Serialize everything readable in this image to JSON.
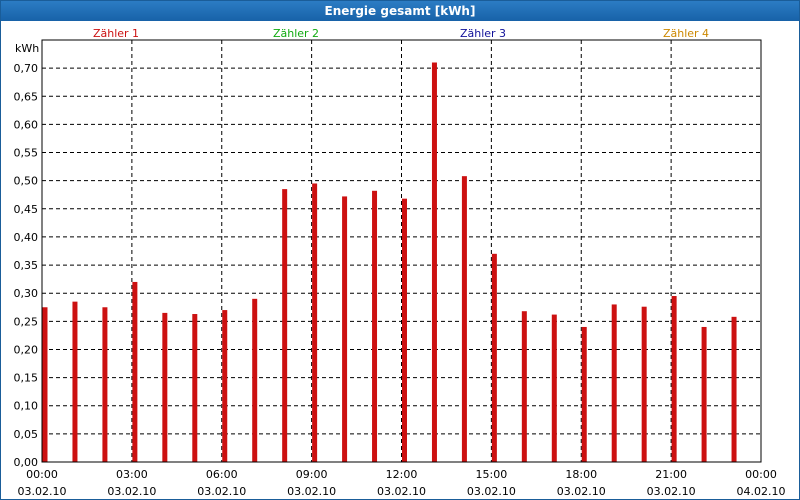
{
  "window": {
    "title": "Energie gesamt [kWh]"
  },
  "colors": {
    "bar": "#cc1111",
    "legend": [
      "#cc1111",
      "#11aa11",
      "#111199",
      "#cc8800"
    ]
  },
  "chart_data": {
    "type": "bar",
    "title": "Energie gesamt [kWh]",
    "ylabel": "kWh",
    "xlabel": "",
    "ylim": [
      0,
      0.75
    ],
    "xlim": [
      0,
      24
    ],
    "grid": true,
    "legend_position": "top",
    "y_ticks": [
      "0,00",
      "0,05",
      "0,10",
      "0,15",
      "0,20",
      "0,25",
      "0,30",
      "0,35",
      "0,40",
      "0,45",
      "0,50",
      "0,55",
      "0,60",
      "0,65",
      "0,70"
    ],
    "x_ticks": [
      {
        "time": "00:00",
        "date": "03.02.10"
      },
      {
        "time": "03:00",
        "date": "03.02.10"
      },
      {
        "time": "06:00",
        "date": "03.02.10"
      },
      {
        "time": "09:00",
        "date": "03.02.10"
      },
      {
        "time": "12:00",
        "date": "03.02.10"
      },
      {
        "time": "15:00",
        "date": "03.02.10"
      },
      {
        "time": "18:00",
        "date": "03.02.10"
      },
      {
        "time": "21:00",
        "date": "03.02.10"
      },
      {
        "time": "00:00",
        "date": "04.02.10"
      }
    ],
    "legend": [
      "Zähler 1",
      "Zähler 2",
      "Zähler 3",
      "Zähler 4"
    ],
    "series": [
      {
        "x": [
          0,
          1,
          2,
          3,
          4,
          5,
          6,
          7,
          8,
          9,
          10,
          11,
          12,
          13,
          14,
          15,
          16,
          17,
          18,
          19,
          20,
          21,
          22,
          23
        ],
        "values": [
          0.275,
          0.285,
          0.275,
          0.32,
          0.265,
          0.263,
          0.27,
          0.29,
          0.485,
          0.495,
          0.472,
          0.482,
          0.468,
          0.71,
          0.508,
          0.37,
          0.268,
          0.262,
          0.24,
          0.28,
          0.276,
          0.295,
          0.24,
          0.258
        ]
      }
    ]
  }
}
